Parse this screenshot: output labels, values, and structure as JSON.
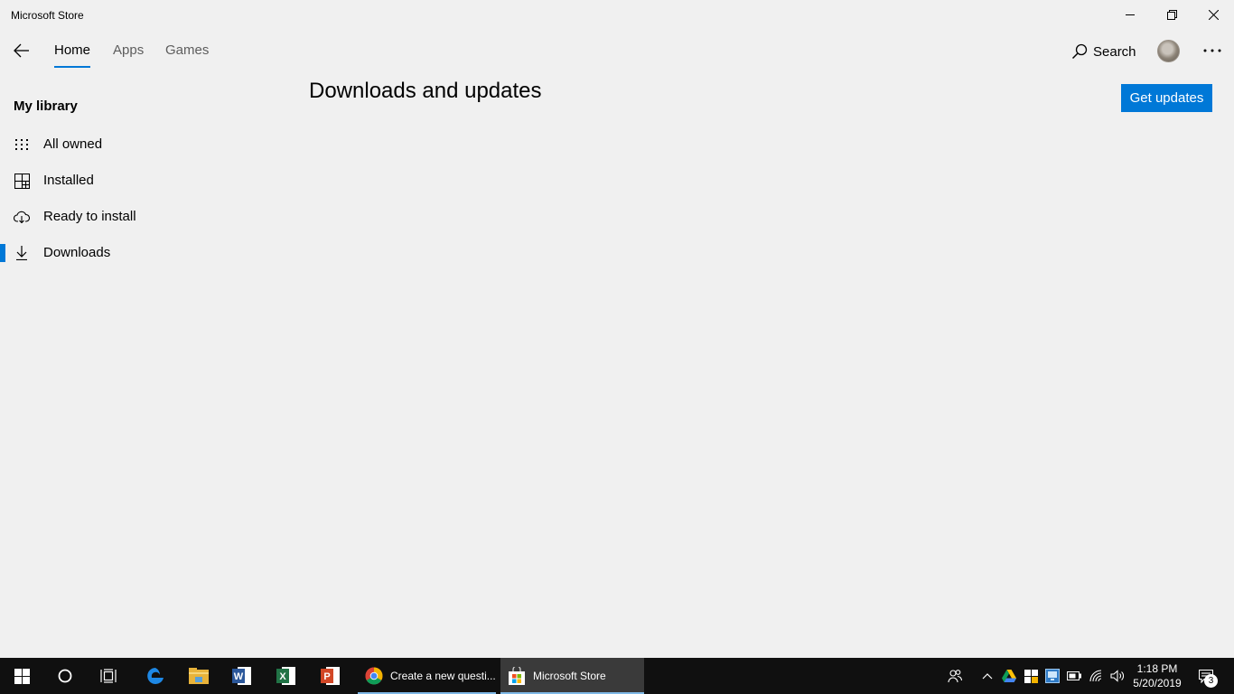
{
  "window": {
    "title": "Microsoft Store",
    "controls": [
      "minimize",
      "restore",
      "close"
    ]
  },
  "nav": {
    "tabs": [
      {
        "label": "Home",
        "active": true
      },
      {
        "label": "Apps",
        "active": false
      },
      {
        "label": "Games",
        "active": false
      }
    ],
    "search_label": "Search"
  },
  "sidebar": {
    "heading": "My library",
    "items": [
      {
        "label": "All owned",
        "icon": "grid-icon"
      },
      {
        "label": "Installed",
        "icon": "installed-icon"
      },
      {
        "label": "Ready to install",
        "icon": "cloud-download-icon"
      },
      {
        "label": "Downloads",
        "icon": "download-icon",
        "active": true
      }
    ]
  },
  "main": {
    "title": "Downloads and updates",
    "get_updates_label": "Get updates"
  },
  "taskbar": {
    "apps": [
      {
        "label": "Create a new questi...",
        "icon": "chrome-icon"
      },
      {
        "label": "Microsoft Store",
        "icon": "store-icon"
      }
    ],
    "clock": {
      "time": "1:18 PM",
      "date": "5/20/2019"
    },
    "notification_count": "3"
  },
  "colors": {
    "accent": "#0078d7",
    "background": "#f0f0f0",
    "taskbar": "#101010"
  }
}
